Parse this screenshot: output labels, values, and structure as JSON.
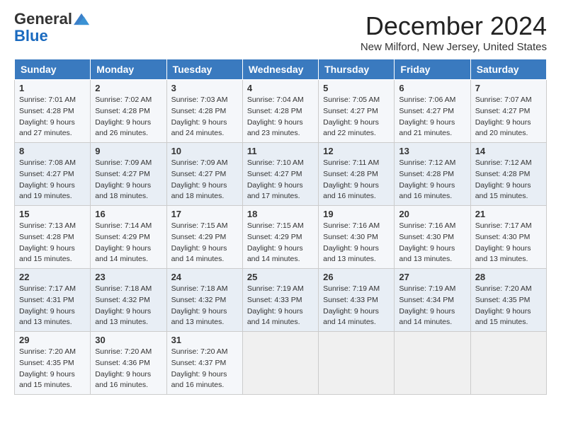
{
  "header": {
    "logo_general": "General",
    "logo_blue": "Blue",
    "month_title": "December 2024",
    "location": "New Milford, New Jersey, United States"
  },
  "weekdays": [
    "Sunday",
    "Monday",
    "Tuesday",
    "Wednesday",
    "Thursday",
    "Friday",
    "Saturday"
  ],
  "weeks": [
    [
      {
        "day": 1,
        "sunrise": "7:01 AM",
        "sunset": "4:28 PM",
        "daylight": "9 hours and 27 minutes."
      },
      {
        "day": 2,
        "sunrise": "7:02 AM",
        "sunset": "4:28 PM",
        "daylight": "9 hours and 26 minutes."
      },
      {
        "day": 3,
        "sunrise": "7:03 AM",
        "sunset": "4:28 PM",
        "daylight": "9 hours and 24 minutes."
      },
      {
        "day": 4,
        "sunrise": "7:04 AM",
        "sunset": "4:28 PM",
        "daylight": "9 hours and 23 minutes."
      },
      {
        "day": 5,
        "sunrise": "7:05 AM",
        "sunset": "4:27 PM",
        "daylight": "9 hours and 22 minutes."
      },
      {
        "day": 6,
        "sunrise": "7:06 AM",
        "sunset": "4:27 PM",
        "daylight": "9 hours and 21 minutes."
      },
      {
        "day": 7,
        "sunrise": "7:07 AM",
        "sunset": "4:27 PM",
        "daylight": "9 hours and 20 minutes."
      }
    ],
    [
      {
        "day": 8,
        "sunrise": "7:08 AM",
        "sunset": "4:27 PM",
        "daylight": "9 hours and 19 minutes."
      },
      {
        "day": 9,
        "sunrise": "7:09 AM",
        "sunset": "4:27 PM",
        "daylight": "9 hours and 18 minutes."
      },
      {
        "day": 10,
        "sunrise": "7:09 AM",
        "sunset": "4:27 PM",
        "daylight": "9 hours and 18 minutes."
      },
      {
        "day": 11,
        "sunrise": "7:10 AM",
        "sunset": "4:27 PM",
        "daylight": "9 hours and 17 minutes."
      },
      {
        "day": 12,
        "sunrise": "7:11 AM",
        "sunset": "4:28 PM",
        "daylight": "9 hours and 16 minutes."
      },
      {
        "day": 13,
        "sunrise": "7:12 AM",
        "sunset": "4:28 PM",
        "daylight": "9 hours and 16 minutes."
      },
      {
        "day": 14,
        "sunrise": "7:12 AM",
        "sunset": "4:28 PM",
        "daylight": "9 hours and 15 minutes."
      }
    ],
    [
      {
        "day": 15,
        "sunrise": "7:13 AM",
        "sunset": "4:28 PM",
        "daylight": "9 hours and 15 minutes."
      },
      {
        "day": 16,
        "sunrise": "7:14 AM",
        "sunset": "4:29 PM",
        "daylight": "9 hours and 14 minutes."
      },
      {
        "day": 17,
        "sunrise": "7:15 AM",
        "sunset": "4:29 PM",
        "daylight": "9 hours and 14 minutes."
      },
      {
        "day": 18,
        "sunrise": "7:15 AM",
        "sunset": "4:29 PM",
        "daylight": "9 hours and 14 minutes."
      },
      {
        "day": 19,
        "sunrise": "7:16 AM",
        "sunset": "4:30 PM",
        "daylight": "9 hours and 13 minutes."
      },
      {
        "day": 20,
        "sunrise": "7:16 AM",
        "sunset": "4:30 PM",
        "daylight": "9 hours and 13 minutes."
      },
      {
        "day": 21,
        "sunrise": "7:17 AM",
        "sunset": "4:30 PM",
        "daylight": "9 hours and 13 minutes."
      }
    ],
    [
      {
        "day": 22,
        "sunrise": "7:17 AM",
        "sunset": "4:31 PM",
        "daylight": "9 hours and 13 minutes."
      },
      {
        "day": 23,
        "sunrise": "7:18 AM",
        "sunset": "4:32 PM",
        "daylight": "9 hours and 13 minutes."
      },
      {
        "day": 24,
        "sunrise": "7:18 AM",
        "sunset": "4:32 PM",
        "daylight": "9 hours and 13 minutes."
      },
      {
        "day": 25,
        "sunrise": "7:19 AM",
        "sunset": "4:33 PM",
        "daylight": "9 hours and 14 minutes."
      },
      {
        "day": 26,
        "sunrise": "7:19 AM",
        "sunset": "4:33 PM",
        "daylight": "9 hours and 14 minutes."
      },
      {
        "day": 27,
        "sunrise": "7:19 AM",
        "sunset": "4:34 PM",
        "daylight": "9 hours and 14 minutes."
      },
      {
        "day": 28,
        "sunrise": "7:20 AM",
        "sunset": "4:35 PM",
        "daylight": "9 hours and 15 minutes."
      }
    ],
    [
      {
        "day": 29,
        "sunrise": "7:20 AM",
        "sunset": "4:35 PM",
        "daylight": "9 hours and 15 minutes."
      },
      {
        "day": 30,
        "sunrise": "7:20 AM",
        "sunset": "4:36 PM",
        "daylight": "9 hours and 16 minutes."
      },
      {
        "day": 31,
        "sunrise": "7:20 AM",
        "sunset": "4:37 PM",
        "daylight": "9 hours and 16 minutes."
      },
      null,
      null,
      null,
      null
    ]
  ],
  "labels": {
    "sunrise": "Sunrise: ",
    "sunset": "Sunset: ",
    "daylight": "Daylight: "
  }
}
